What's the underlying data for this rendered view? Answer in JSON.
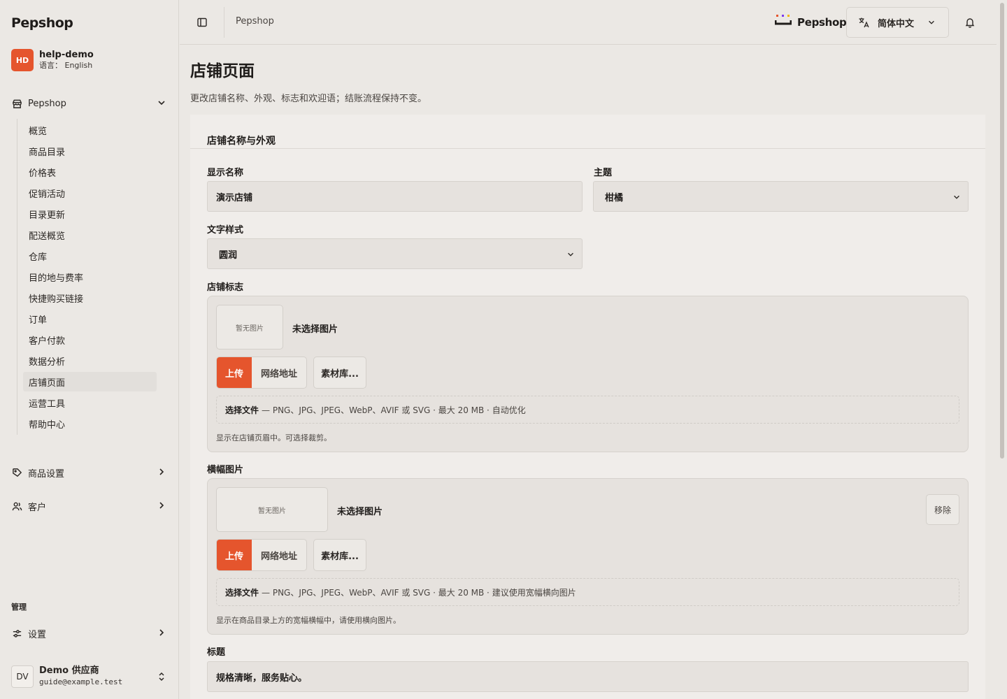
{
  "sidebar": {
    "brand": "Pepshop",
    "org": {
      "badge": "HD",
      "name": "help-demo",
      "sub": "语言： English"
    },
    "group_main": "Pepshop",
    "items": [
      "概览",
      "商品目录",
      "价格表",
      "促销活动",
      "目录更新",
      "配送概览",
      "仓库",
      "目的地与费率",
      "快捷购买链接",
      "订单",
      "客户付款",
      "数据分析",
      "店铺页面",
      "运营工具",
      "帮助中心"
    ],
    "active_item": "店铺页面",
    "group_products": "商品设置",
    "group_customers": "客户",
    "section_admin": "管理",
    "group_settings": "设置",
    "user": {
      "avatar": "DV",
      "name": "Demo 供应商",
      "email": "guide@example.test"
    }
  },
  "topbar": {
    "breadcrumb": "Pepshop",
    "logo_text": "Pepshop",
    "language": "简体中文"
  },
  "page": {
    "title": "店铺页面",
    "description": "更改店铺名称、外观、标志和欢迎语；结账流程保持不变。"
  },
  "form": {
    "section_title": "店铺名称与外观",
    "display_name_label": "显示名称",
    "display_name_value": "演示店铺",
    "theme_label": "主题",
    "theme_value": "柑橘",
    "font_label": "文字样式",
    "font_value": "圆润",
    "logo": {
      "label": "店铺标志",
      "placeholder": "暂无图片",
      "status": "未选择图片",
      "upload": "上传",
      "url": "网络地址",
      "library": "素材库...",
      "drop_title": "选择文件",
      "drop_desc": "— PNG、JPG、JPEG、WebP、AVIF 或 SVG · 最大 20 MB · 自动优化",
      "hint": "显示在店铺页眉中。可选择裁剪。"
    },
    "banner": {
      "label": "横幅图片",
      "placeholder": "暂无图片",
      "status": "未选择图片",
      "remove": "移除",
      "upload": "上传",
      "url": "网络地址",
      "library": "素材库...",
      "drop_title": "选择文件",
      "drop_desc": "— PNG、JPG、JPEG、WebP、AVIF 或 SVG · 最大 20 MB · 建议使用宽幅横向图片",
      "hint": "显示在商品目录上方的宽幅横幅中，请使用横向图片。"
    },
    "headline_label": "标题",
    "headline_value": "规格清晰，服务贴心。"
  },
  "colors": {
    "accent": "#e5552d",
    "background": "#ebe8e4",
    "card": "#f0edea"
  }
}
